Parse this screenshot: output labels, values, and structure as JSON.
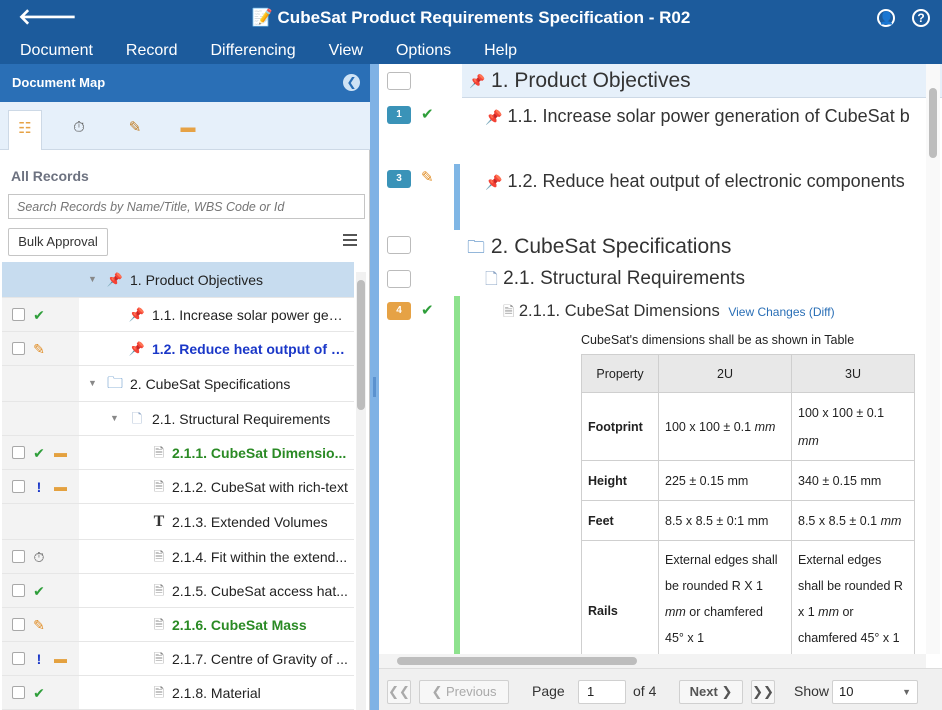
{
  "titlebar": {
    "title": "📝 CubeSat Product Requirements Specification - R02",
    "back_glyph": "🡐",
    "user_glyph": "👤",
    "help_glyph": "?"
  },
  "menu": [
    {
      "label": "Document"
    },
    {
      "label": "Record"
    },
    {
      "label": "Differencing"
    },
    {
      "label": "View"
    },
    {
      "label": "Options"
    },
    {
      "label": "Help"
    }
  ],
  "document_map": {
    "title": "Document Map",
    "collapse_glyph": "❮",
    "tabs": [
      {
        "name": "tree",
        "glyph": "☷"
      },
      {
        "name": "history",
        "glyph": "⏱"
      },
      {
        "name": "edit",
        "glyph": "✎"
      },
      {
        "name": "comments",
        "glyph": "▬"
      }
    ],
    "all_records": "All Records",
    "search_placeholder": "Search Records by Name/Title, WBS Code or Id",
    "bulk_approval": "Bulk Approval",
    "rows": [
      {
        "label": "1. Product Objectives",
        "status": "",
        "comment": "",
        "icon": "📌",
        "level": 0,
        "style": "",
        "checkbox": false,
        "expand": "▼"
      },
      {
        "label": "1.1. Increase solar power gen...",
        "status": "✔",
        "comment": "",
        "icon": "📌",
        "level": 1,
        "style": "",
        "checkbox": true,
        "expand": ""
      },
      {
        "label": "1.2. Reduce heat output of e...",
        "status": "✎",
        "comment": "",
        "icon": "📌",
        "level": 1,
        "style": "blue",
        "checkbox": true,
        "expand": ""
      },
      {
        "label": "2. CubeSat Specifications",
        "status": "",
        "comment": "",
        "icon": "🗀",
        "level": 0,
        "style": "",
        "checkbox": false,
        "expand": "▼"
      },
      {
        "label": "2.1. Structural Requirements",
        "status": "",
        "comment": "",
        "icon": "🗋",
        "level": 1,
        "style": "",
        "checkbox": false,
        "expand": "▼"
      },
      {
        "label": "2.1.1. CubeSat Dimensio...",
        "status": "✔",
        "comment": "▬",
        "icon": "🗎",
        "level": 2,
        "style": "green",
        "checkbox": true,
        "expand": ""
      },
      {
        "label": "2.1.2. CubeSat with rich-text",
        "status": "!",
        "comment": "▬",
        "icon": "🗎",
        "level": 2,
        "style": "",
        "checkbox": true,
        "expand": ""
      },
      {
        "label": "2.1.3. Extended Volumes",
        "status": "",
        "comment": "",
        "icon": "T",
        "level": 2,
        "style": "",
        "checkbox": false,
        "expand": ""
      },
      {
        "label": "2.1.4. Fit within the extend...",
        "status": "⏱",
        "comment": "",
        "icon": "🗎",
        "level": 2,
        "style": "",
        "checkbox": true,
        "expand": ""
      },
      {
        "label": "2.1.5. CubeSat access hat...",
        "status": "✔",
        "comment": "",
        "icon": "🗎",
        "level": 2,
        "style": "",
        "checkbox": true,
        "expand": ""
      },
      {
        "label": "2.1.6. CubeSat Mass",
        "status": "✎",
        "comment": "",
        "icon": "🗎",
        "level": 2,
        "style": "green",
        "checkbox": true,
        "expand": ""
      },
      {
        "label": "2.1.7. Centre of Gravity of ...",
        "status": "!",
        "comment": "▬",
        "icon": "🗎",
        "level": 2,
        "style": "",
        "checkbox": true,
        "expand": ""
      },
      {
        "label": "2.1.8. Material",
        "status": "✔",
        "comment": "",
        "icon": "🗎",
        "level": 2,
        "style": "",
        "checkbox": true,
        "expand": ""
      }
    ]
  },
  "content": {
    "items": [
      {
        "heading": "1. Product Objectives",
        "icon": "📌",
        "comment_count": "",
        "status": ""
      },
      {
        "heading": "1.1. Increase solar power generation of CubeSat b",
        "icon": "📌",
        "comment_count": "1",
        "status": "✔"
      },
      {
        "heading": "1.2. Reduce heat output of electronic components",
        "icon": "📌",
        "comment_count": "3",
        "status": "✎"
      },
      {
        "heading": "2. CubeSat Specifications",
        "icon": "🗀",
        "comment_count": "",
        "status": ""
      },
      {
        "heading": "2.1. Structural Requirements",
        "icon": "🗋",
        "comment_count": "",
        "status": ""
      },
      {
        "heading": "2.1.1. CubeSat Dimensions",
        "icon": "🗎",
        "comment_count": "4",
        "status": "✔"
      }
    ],
    "view_changes": "View Changes (Diff)",
    "description": "CubeSat's dimensions shall be as shown in Table",
    "table": {
      "headers": [
        "Property",
        "2U",
        "3U"
      ],
      "rows": [
        {
          "prop": "Footprint",
          "c2u": "100 x 100 ± 0.1",
          "u2u": "mm",
          "c3u": "100 x 100 ± 0.1",
          "u3u": "mm"
        },
        {
          "prop": "Height",
          "c2u": "225 ± 0.15 mm",
          "u2u": "",
          "c3u": "340 ± 0.15 mm",
          "u3u": ""
        },
        {
          "prop": "Feet",
          "c2u": "8.5 x 8.5 ± 0:1 mm",
          "u2u": "",
          "c3u": "8.5 x 8.5 ± 0.1",
          "u3u": "mm"
        },
        {
          "prop": "Rails",
          "c2u": "External edges shall be rounded R X 1",
          "u2u": "mm",
          "c2u_tail": " or chamfered 45° x 1",
          "c3u": "External edges shall be rounded R x 1",
          "u3u": "mm",
          "c3u_tail": " or chamfered 45° x 1"
        }
      ]
    }
  },
  "pager": {
    "first": "❮❮",
    "previous": "❮ Previous",
    "page_label": "Page",
    "page_value": "1",
    "of_label": "of 4",
    "next": "Next ❯",
    "last": "❯❯",
    "show_label": "Show",
    "show_value": "10"
  }
}
